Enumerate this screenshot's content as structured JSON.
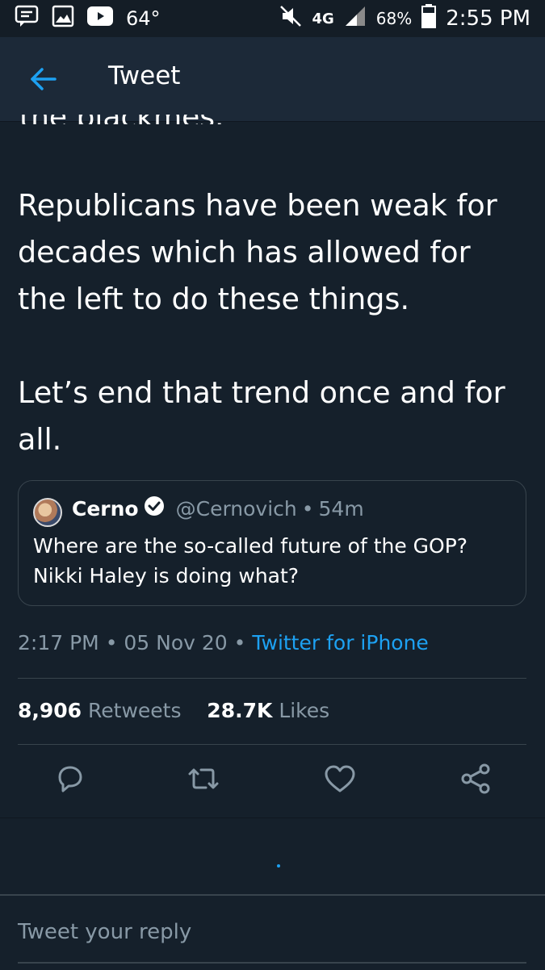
{
  "status_bar": {
    "temperature": "64°",
    "network": "4G",
    "battery": "68%",
    "time": "2:55 PM"
  },
  "header": {
    "title": "Tweet"
  },
  "tweet": {
    "cut_off_line": "the blackmes.",
    "paragraphs": [
      "Republicans have been weak for decades which has allowed for the left to do these things.",
      "Let’s end that trend once and for all."
    ],
    "time": "2:17 PM",
    "separator": "•",
    "date": "05 Nov 20",
    "source": "Twitter for iPhone",
    "retweets_count": "8,906",
    "retweets_label": "Retweets",
    "likes_count": "28.7K",
    "likes_label": "Likes"
  },
  "quoted_tweet": {
    "name": "Cerno",
    "handle": "@Cernovich",
    "separator": "•",
    "age": "54m",
    "text_line1": "Where are the so-called future of the GOP?",
    "text_line2": "Nikki Haley is doing what?"
  },
  "reply": {
    "placeholder": "Tweet your reply"
  },
  "colors": {
    "background": "#15202b",
    "header": "#1c2938",
    "accent": "#1da1f2",
    "muted_text": "#8899a6",
    "border": "#38444d"
  },
  "icons": [
    "message-icon",
    "image-icon",
    "youtube-icon",
    "mute-icon",
    "signal-icon",
    "battery-icon",
    "back-arrow-icon",
    "verified-badge-icon",
    "reply-icon",
    "retweet-icon",
    "like-icon",
    "share-icon"
  ]
}
